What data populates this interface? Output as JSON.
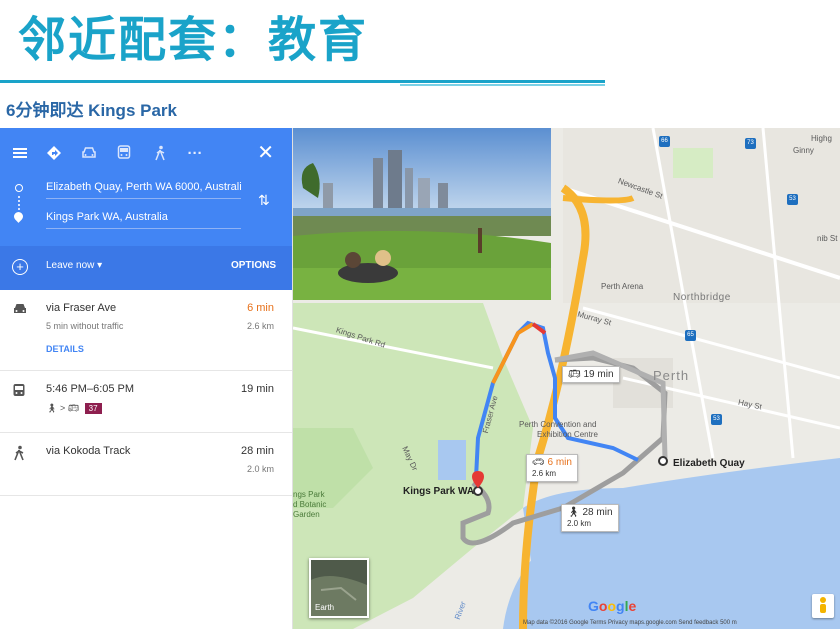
{
  "slide": {
    "title": "邻近配套：教育",
    "subtitle": "6分钟即达 Kings Park"
  },
  "directions": {
    "modes": [
      "menu-icon",
      "directions-icon",
      "car-icon",
      "transit-icon",
      "walk-icon",
      "more-icon"
    ],
    "more_label": "···",
    "close_label": "✕",
    "origin": "Elizabeth Quay, Perth WA 6000, Australi",
    "destination": "Kings Park WA, Australia",
    "leave_now": "Leave now ▾",
    "options": "OPTIONS",
    "routes": [
      {
        "title": "via Fraser Ave",
        "time": "6 min",
        "sub": "5 min without traffic",
        "dist": "2.6 km",
        "link": "DETAILS"
      },
      {
        "title": "5:46 PM–6:05 PM",
        "time": "19 min",
        "bus": "37"
      },
      {
        "title": "via Kokoda Track",
        "time": "28 min",
        "dist": "2.0 km"
      }
    ]
  },
  "map": {
    "labels": {
      "newcastle": "Newcastle St",
      "perth_arena": "Perth Arena",
      "northbridge": "Northbridge",
      "murray": "Murray St",
      "perth": "Perth",
      "hay": "Hay St",
      "kings_park_rd": "Kings Park Rd",
      "mayst": "May Dr",
      "fraser": "Fraser Ave",
      "convention": "Perth Convention and",
      "convention2": "Exhibition Centre",
      "elizabeth_quay": "Elizabeth Quay",
      "kings_park": "Kings Park WA",
      "botanic1": "ngs Park",
      "botanic2": "d Botanic",
      "botanic3": "Garden",
      "river": "River",
      "highgate": "Highg",
      "ginny": "Ginny",
      "lord": "nib St"
    },
    "callouts": {
      "transit_time": "19 min",
      "drive_time": "6 min",
      "drive_dist": "2.6 km",
      "walk_time": "28 min",
      "walk_dist": "2.0 km"
    },
    "shields": [
      "66",
      "73",
      "53",
      "65",
      "53"
    ],
    "earth_label": "Earth",
    "google_letters": [
      "G",
      "o",
      "o",
      "g",
      "l",
      "e"
    ],
    "google_colors": [
      "#4285f4",
      "#ea4335",
      "#fbbc05",
      "#4285f4",
      "#34a853",
      "#ea4335"
    ],
    "footer": "Map data ©2016 Google    Terms    Privacy    maps.google.com    Send feedback    500 m"
  }
}
